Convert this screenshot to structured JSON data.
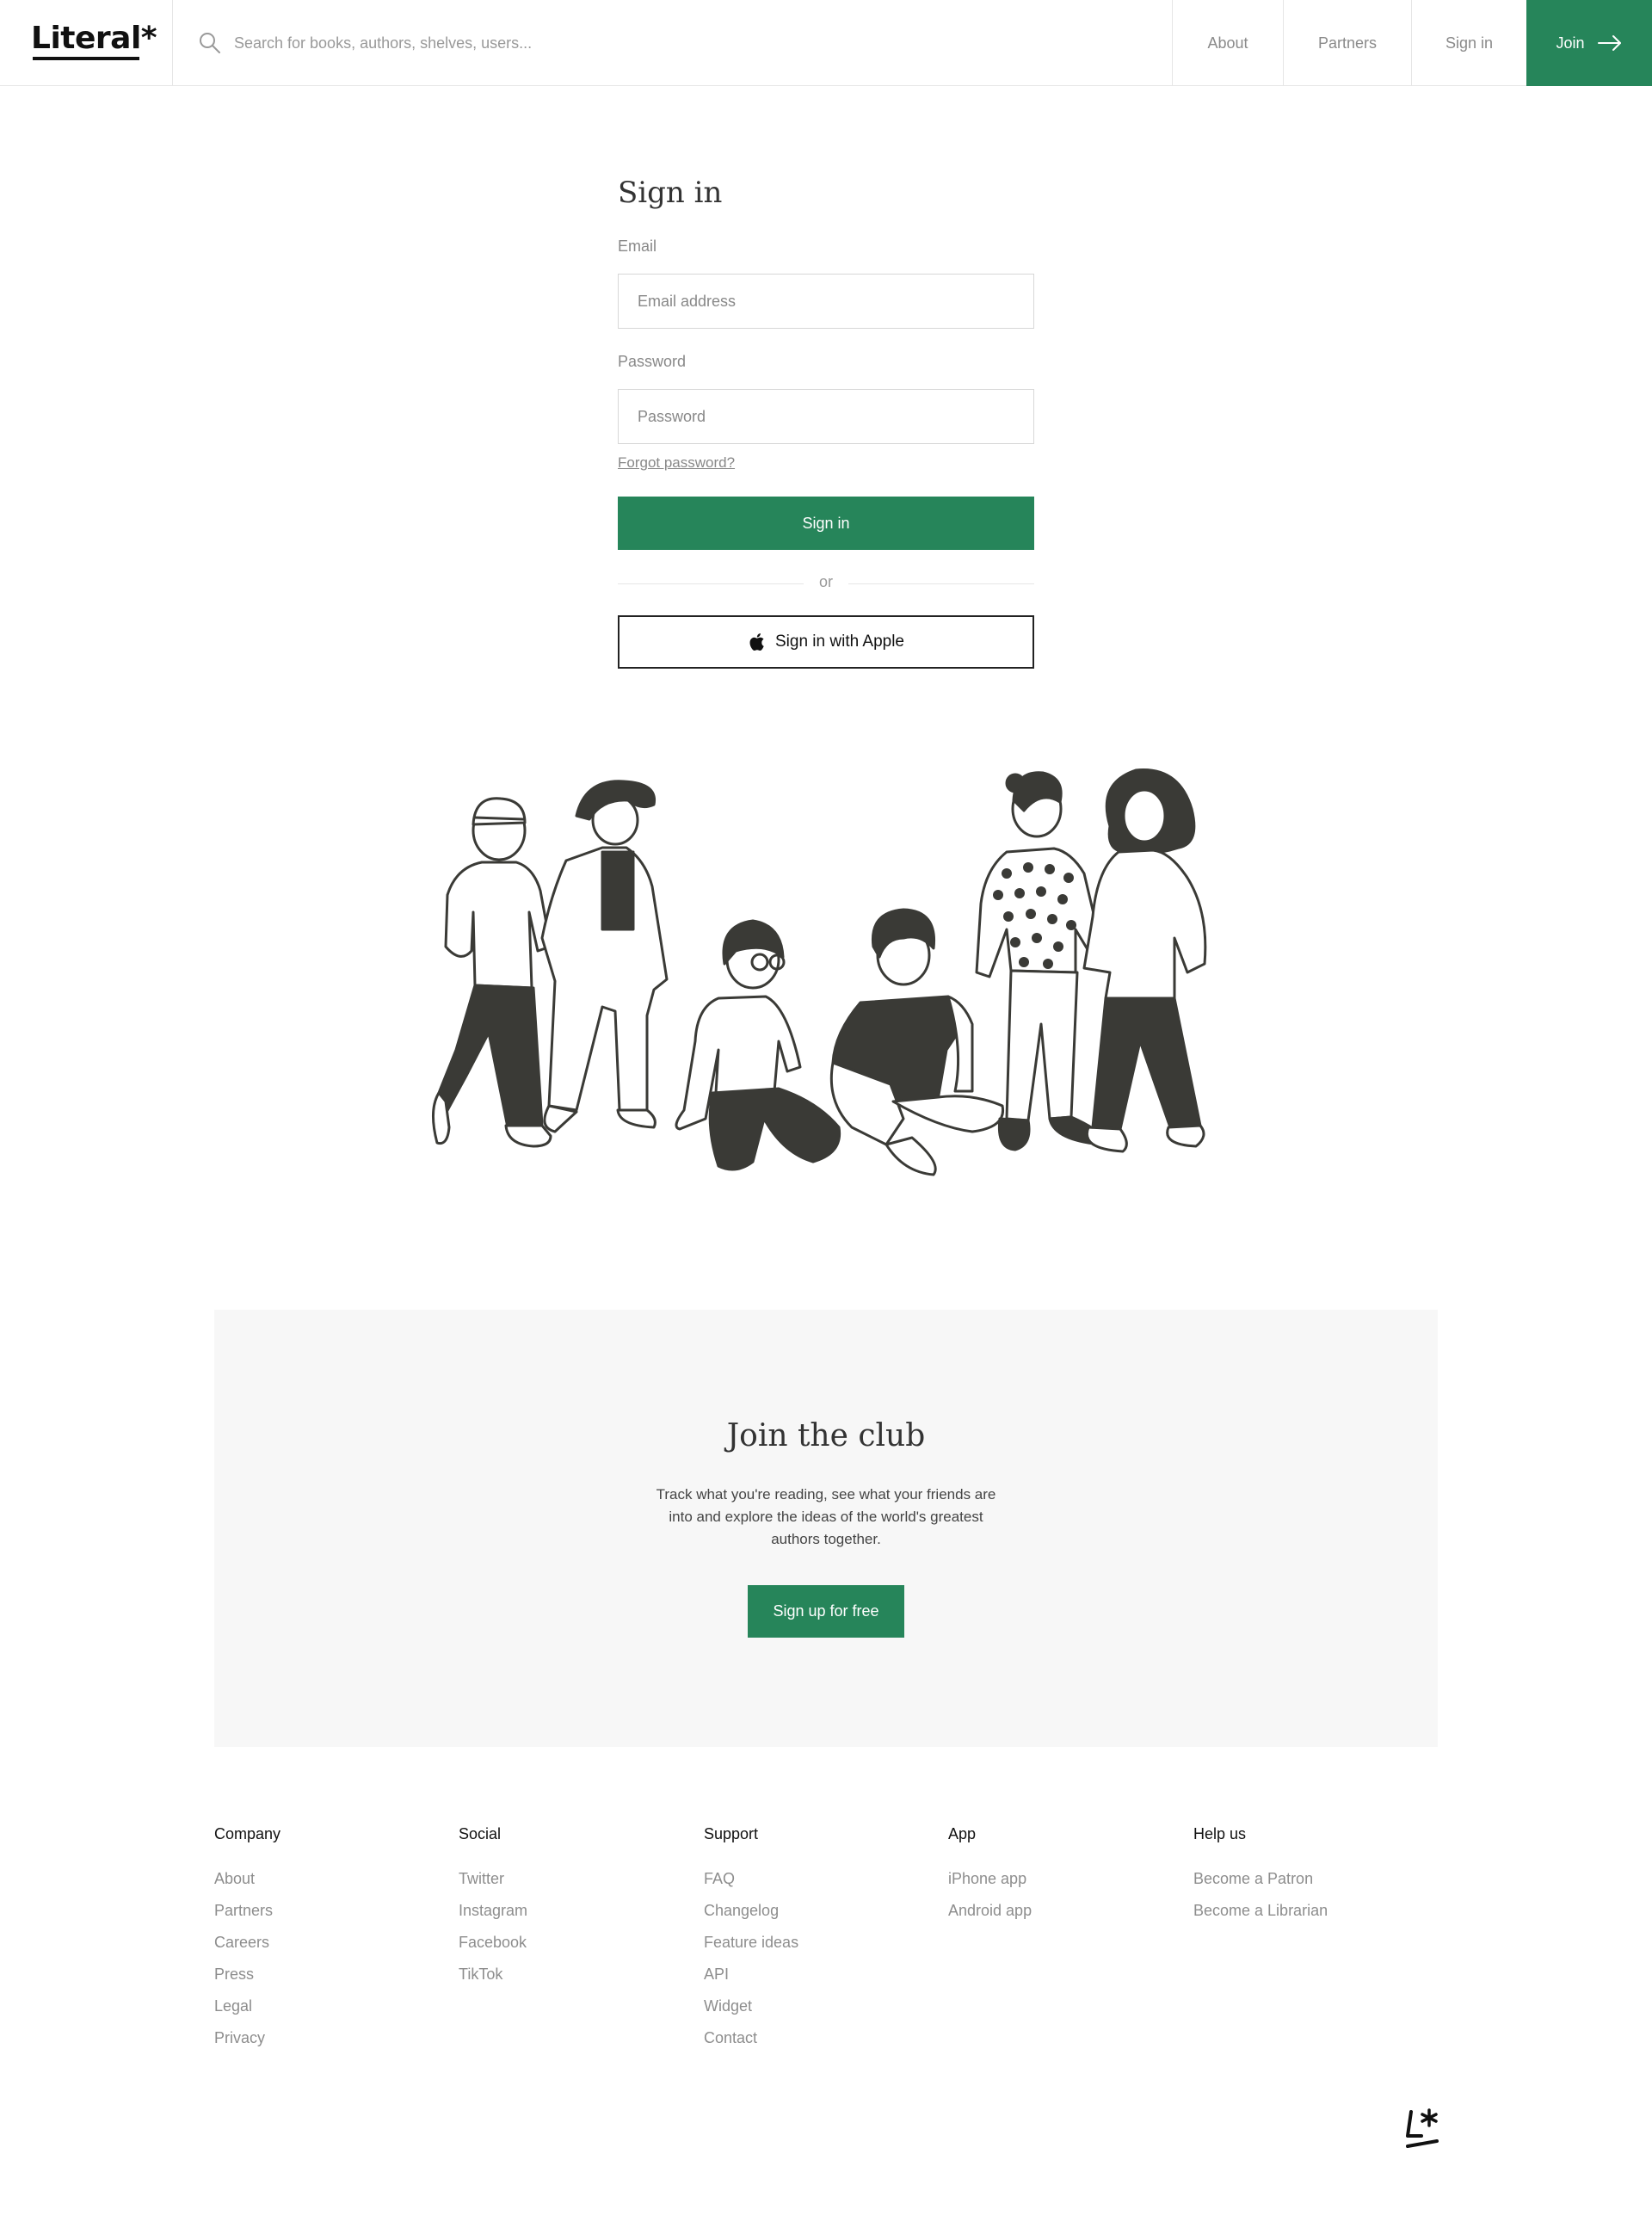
{
  "header": {
    "logo_text": "Literal*",
    "search_placeholder": "Search for books, authors, shelves, users...",
    "nav": {
      "about": "About",
      "partners": "Partners",
      "signin": "Sign in",
      "join": "Join"
    }
  },
  "signin": {
    "title": "Sign in",
    "email_label": "Email",
    "email_placeholder": "Email address",
    "email_value": "",
    "password_label": "Password",
    "password_placeholder": "Password",
    "password_value": "",
    "forgot": "Forgot password?",
    "submit": "Sign in",
    "divider": "or",
    "apple": "Sign in with Apple"
  },
  "club": {
    "title": "Join the club",
    "text": "Track what you're reading, see what your friends are into and explore the ideas of the world's greatest authors together.",
    "button": "Sign up for free"
  },
  "footer": {
    "columns": [
      {
        "heading": "Company",
        "links": [
          "About",
          "Partners",
          "Careers",
          "Press",
          "Legal",
          "Privacy"
        ]
      },
      {
        "heading": "Social",
        "links": [
          "Twitter",
          "Instagram",
          "Facebook",
          "TikTok"
        ]
      },
      {
        "heading": "Support",
        "links": [
          "FAQ",
          "Changelog",
          "Feature ideas",
          "API",
          "Widget",
          "Contact"
        ]
      },
      {
        "heading": "App",
        "links": [
          "iPhone app",
          "Android app"
        ]
      },
      {
        "heading": "Help us",
        "links": [
          "Become a Patron",
          "Become a Librarian"
        ]
      }
    ]
  },
  "colors": {
    "accent": "#26855a",
    "dark": "#333333",
    "muted": "#8d8d8d",
    "panel": "#f7f7f7"
  },
  "icons": [
    "search-icon",
    "arrow-right-icon",
    "apple-icon",
    "logo-mark-icon"
  ]
}
